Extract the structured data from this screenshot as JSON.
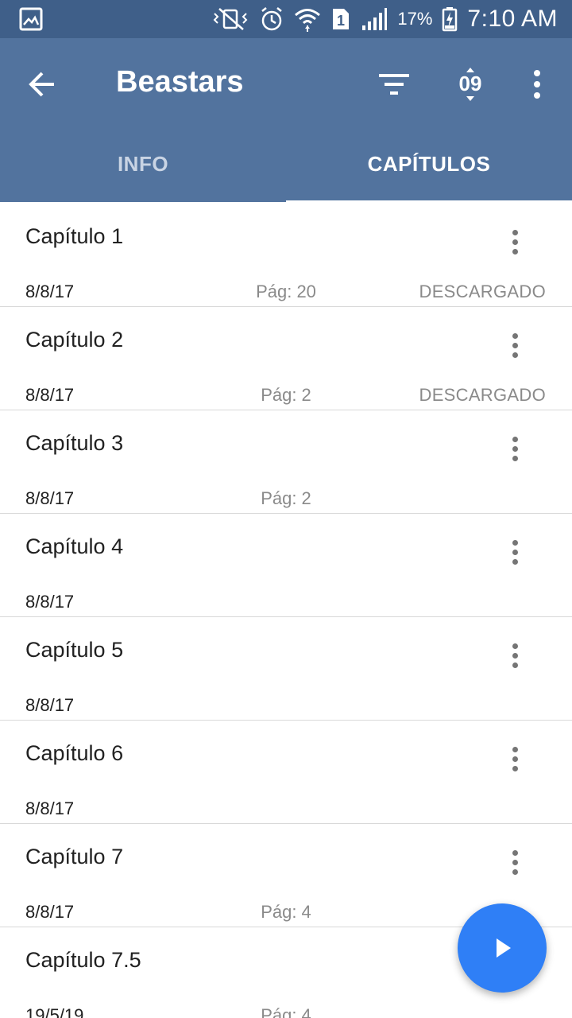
{
  "status_bar": {
    "battery": "17%",
    "time": "7:10 AM",
    "sim_slot": "1",
    "icons": [
      "gallery-icon",
      "vibrate-icon",
      "alarm-icon",
      "wifi-icon",
      "sim-icon",
      "signal-icon",
      "battery-icon"
    ]
  },
  "app_bar": {
    "title": "Beastars",
    "sort_number": "09",
    "colors": {
      "status_bar": "#3f5f89",
      "app_bar": "#52739e",
      "fab": "#2f7ff6"
    }
  },
  "tabs": [
    {
      "label": "INFO",
      "selected": false
    },
    {
      "label": "CAPÍTULOS",
      "selected": true
    }
  ],
  "chapters": [
    {
      "title": "Capítulo 1",
      "date": "8/8/17",
      "page": "Pág: 20",
      "status": "DESCARGADO"
    },
    {
      "title": "Capítulo 2",
      "date": "8/8/17",
      "page": "Pág: 2",
      "status": "DESCARGADO"
    },
    {
      "title": "Capítulo 3",
      "date": "8/8/17",
      "page": "Pág: 2",
      "status": ""
    },
    {
      "title": "Capítulo 4",
      "date": "8/8/17",
      "page": "",
      "status": ""
    },
    {
      "title": "Capítulo 5",
      "date": "8/8/17",
      "page": "",
      "status": ""
    },
    {
      "title": "Capítulo 6",
      "date": "8/8/17",
      "page": "",
      "status": ""
    },
    {
      "title": "Capítulo 7",
      "date": "8/8/17",
      "page": "Pág: 4",
      "status": ""
    },
    {
      "title": "Capítulo 7.5",
      "date": "19/5/19",
      "page": "Pág: 4",
      "status": ""
    }
  ]
}
